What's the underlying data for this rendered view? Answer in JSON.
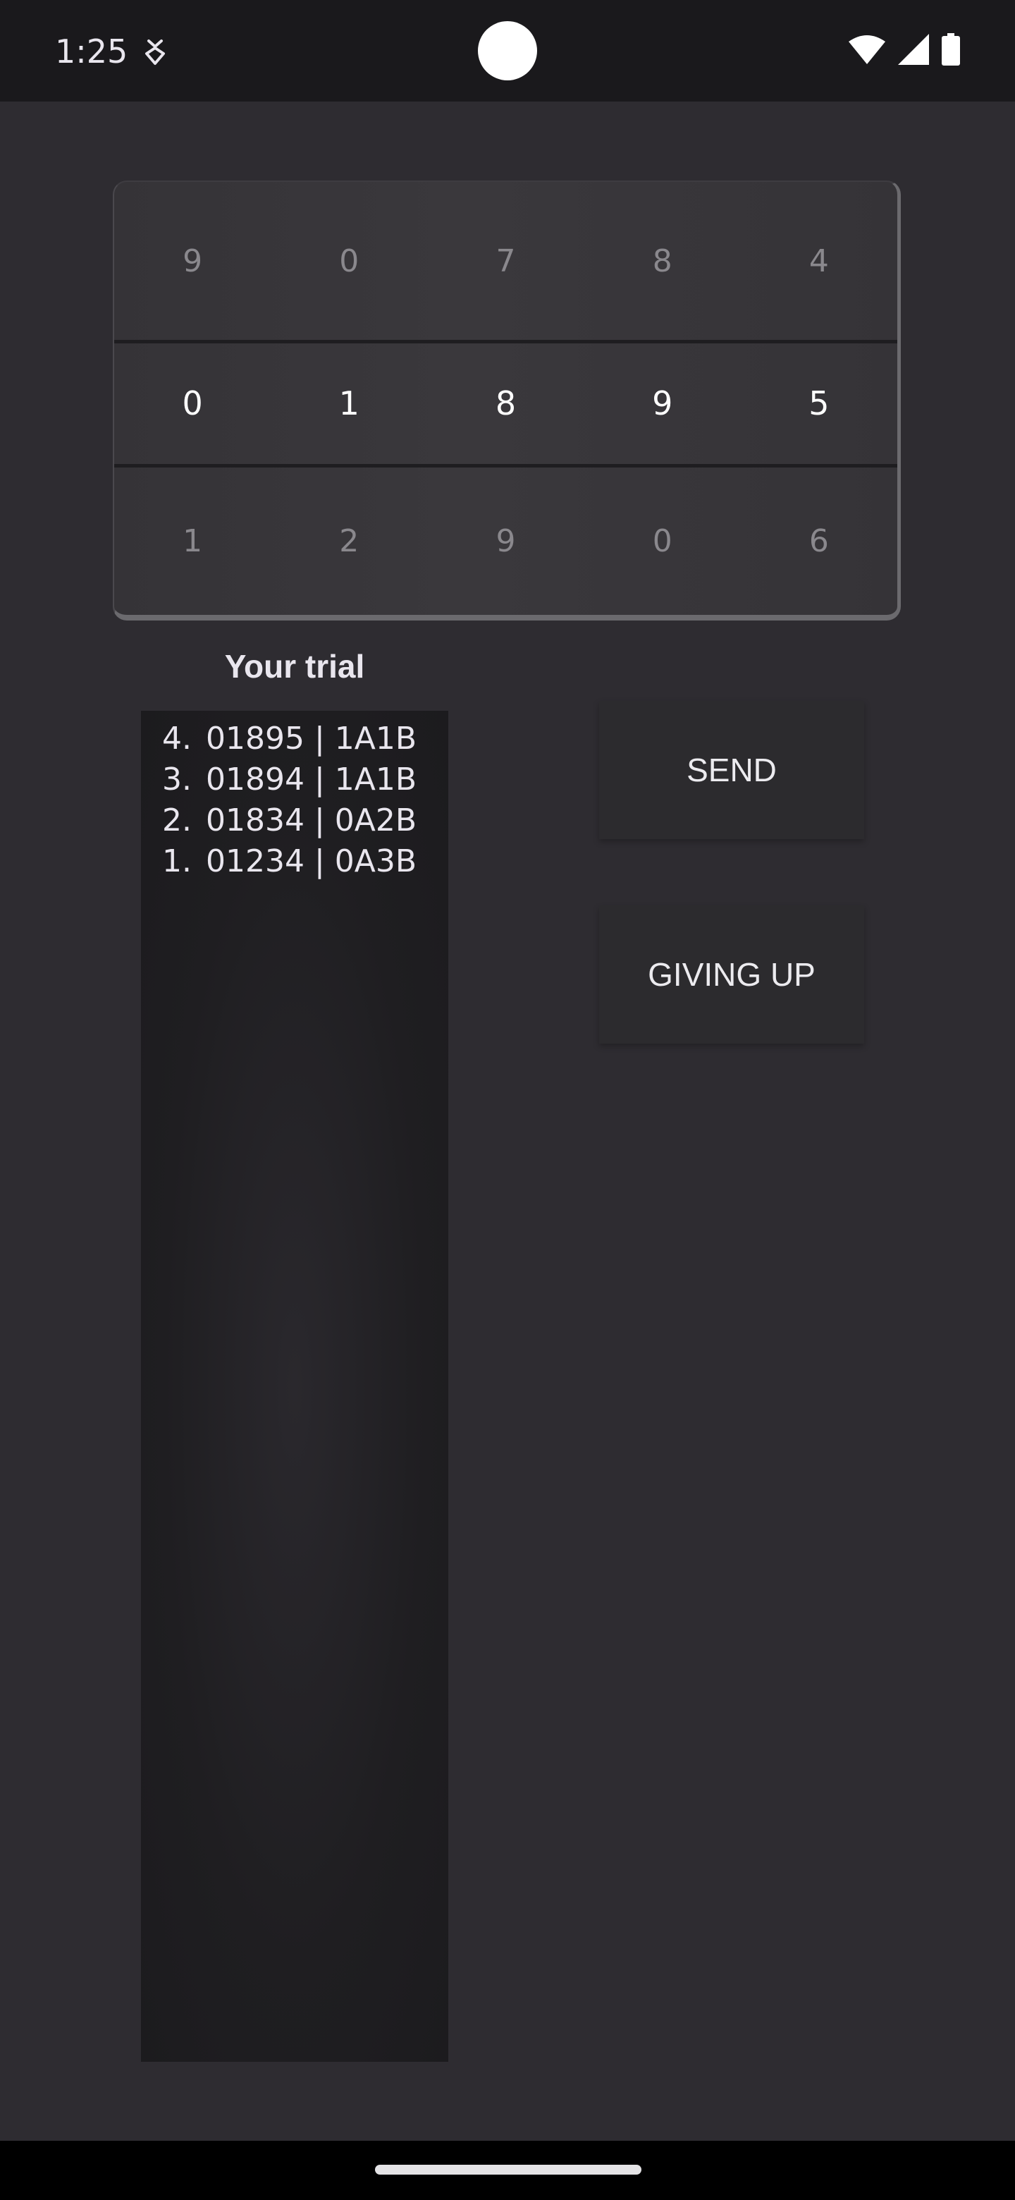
{
  "status_bar": {
    "time": "1:25",
    "notification_icon": "android-debug-icon",
    "icons": [
      "wifi-icon",
      "signal-icon",
      "battery-icon"
    ]
  },
  "picker": {
    "columns": [
      {
        "prev": "9",
        "current": "0",
        "next": "1"
      },
      {
        "prev": "0",
        "current": "1",
        "next": "2"
      },
      {
        "prev": "7",
        "current": "8",
        "next": "9"
      },
      {
        "prev": "8",
        "current": "9",
        "next": "0"
      },
      {
        "prev": "4",
        "current": "5",
        "next": "6"
      }
    ]
  },
  "trials": {
    "title": "Your trial",
    "items": [
      {
        "num": "4.",
        "text": "01895 | 1A1B"
      },
      {
        "num": "3.",
        "text": "01894 | 1A1B"
      },
      {
        "num": "2.",
        "text": "01834 | 0A2B"
      },
      {
        "num": "1.",
        "text": "01234 | 0A3B"
      }
    ]
  },
  "buttons": {
    "send_label": "SEND",
    "giveup_label": "GIVING UP"
  },
  "colors": {
    "background": "#2e2c31",
    "status_bar": "#1a191c",
    "button": "#2c2b2e",
    "text": "#e9e6ee"
  }
}
